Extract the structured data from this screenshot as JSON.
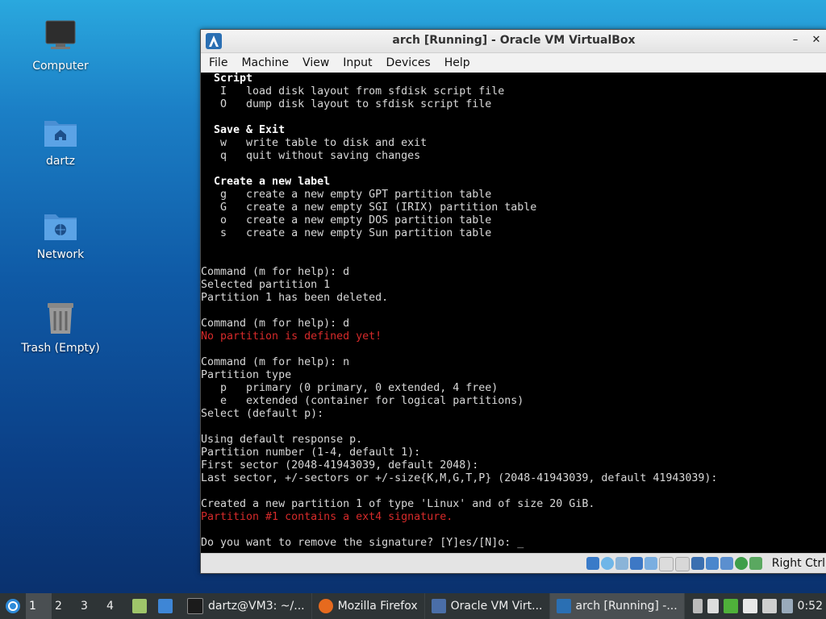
{
  "desktop": {
    "icons": [
      {
        "label": "Computer",
        "icon": "monitor-icon"
      },
      {
        "label": "dartz",
        "icon": "home-folder-icon"
      },
      {
        "label": "Network",
        "icon": "network-folder-icon"
      },
      {
        "label": "Trash (Empty)",
        "icon": "trash-icon"
      }
    ]
  },
  "window": {
    "title": "arch [Running] - Oracle VM VirtualBox",
    "menu": [
      "File",
      "Machine",
      "View",
      "Input",
      "Devices",
      "Help"
    ],
    "status_right": "Right Ctrl"
  },
  "terminal": {
    "lines": [
      {
        "t": "  Script",
        "s": "b"
      },
      {
        "t": "   I   load disk layout from sfdisk script file",
        "s": ""
      },
      {
        "t": "   O   dump disk layout to sfdisk script file",
        "s": ""
      },
      {
        "t": "",
        "s": ""
      },
      {
        "t": "  Save & Exit",
        "s": "b"
      },
      {
        "t": "   w   write table to disk and exit",
        "s": ""
      },
      {
        "t": "   q   quit without saving changes",
        "s": ""
      },
      {
        "t": "",
        "s": ""
      },
      {
        "t": "  Create a new label",
        "s": "b"
      },
      {
        "t": "   g   create a new empty GPT partition table",
        "s": ""
      },
      {
        "t": "   G   create a new empty SGI (IRIX) partition table",
        "s": ""
      },
      {
        "t": "   o   create a new empty DOS partition table",
        "s": ""
      },
      {
        "t": "   s   create a new empty Sun partition table",
        "s": ""
      },
      {
        "t": "",
        "s": ""
      },
      {
        "t": "",
        "s": ""
      },
      {
        "t": "Command (m for help): d",
        "s": ""
      },
      {
        "t": "Selected partition 1",
        "s": ""
      },
      {
        "t": "Partition 1 has been deleted.",
        "s": ""
      },
      {
        "t": "",
        "s": ""
      },
      {
        "t": "Command (m for help): d",
        "s": ""
      },
      {
        "t": "No partition is defined yet!",
        "s": "r"
      },
      {
        "t": "",
        "s": ""
      },
      {
        "t": "Command (m for help): n",
        "s": ""
      },
      {
        "t": "Partition type",
        "s": ""
      },
      {
        "t": "   p   primary (0 primary, 0 extended, 4 free)",
        "s": ""
      },
      {
        "t": "   e   extended (container for logical partitions)",
        "s": ""
      },
      {
        "t": "Select (default p):",
        "s": ""
      },
      {
        "t": "",
        "s": ""
      },
      {
        "t": "Using default response p.",
        "s": ""
      },
      {
        "t": "Partition number (1-4, default 1):",
        "s": ""
      },
      {
        "t": "First sector (2048-41943039, default 2048):",
        "s": ""
      },
      {
        "t": "Last sector, +/-sectors or +/-size{K,M,G,T,P} (2048-41943039, default 41943039):",
        "s": ""
      },
      {
        "t": "",
        "s": ""
      },
      {
        "t": "Created a new partition 1 of type 'Linux' and of size 20 GiB.",
        "s": ""
      },
      {
        "t": "Partition #1 contains a ext4 signature.",
        "s": "r"
      },
      {
        "t": "",
        "s": ""
      },
      {
        "t": "Do you want to remove the signature? [Y]es/[N]o: _",
        "s": ""
      }
    ]
  },
  "taskbar": {
    "workspaces": [
      "1",
      "2",
      "3",
      "4"
    ],
    "active_workspace": "1",
    "tasks": [
      {
        "label": "dartz@VM3: ~/...",
        "icon": "terminal-icon"
      },
      {
        "label": "Mozilla Firefox",
        "icon": "firefox-icon"
      },
      {
        "label": "Oracle VM Virt...",
        "icon": "virtualbox-icon"
      },
      {
        "label": "arch [Running] -...",
        "icon": "arch-icon"
      }
    ],
    "clock": "0:52"
  },
  "colors": {
    "terminal_bg": "#000000",
    "error": "#d62a2a",
    "taskbar": "#2e3436"
  }
}
